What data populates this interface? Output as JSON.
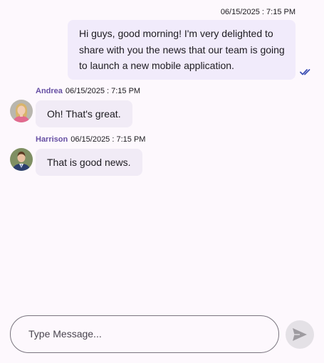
{
  "messages": [
    {
      "direction": "outgoing",
      "timestamp": "06/15/2025 : 7:15 PM",
      "text": "Hi guys, good morning! I'm very delighted to share with you the news that our team is going to launch a new mobile application.",
      "status_icon": "double-check-icon"
    },
    {
      "direction": "incoming",
      "sender": "Andrea",
      "timestamp": "06/15/2025 : 7:15 PM",
      "text": "Oh! That's great.",
      "avatar_icon": "avatar-andrea"
    },
    {
      "direction": "incoming",
      "sender": "Harrison",
      "timestamp": "06/15/2025 : 7:15 PM",
      "text": "That is good news.",
      "avatar_icon": "avatar-harrison"
    }
  ],
  "composer": {
    "placeholder": "Type Message...",
    "send_icon": "send-icon"
  },
  "colors": {
    "background": "#fdf8fd",
    "outgoing_bubble": "#f1ebfb",
    "incoming_bubble": "#f1ebf6",
    "sender_name": "#6750a4",
    "read_check": "#3f51b5",
    "send_button": "#e4e1e6"
  }
}
